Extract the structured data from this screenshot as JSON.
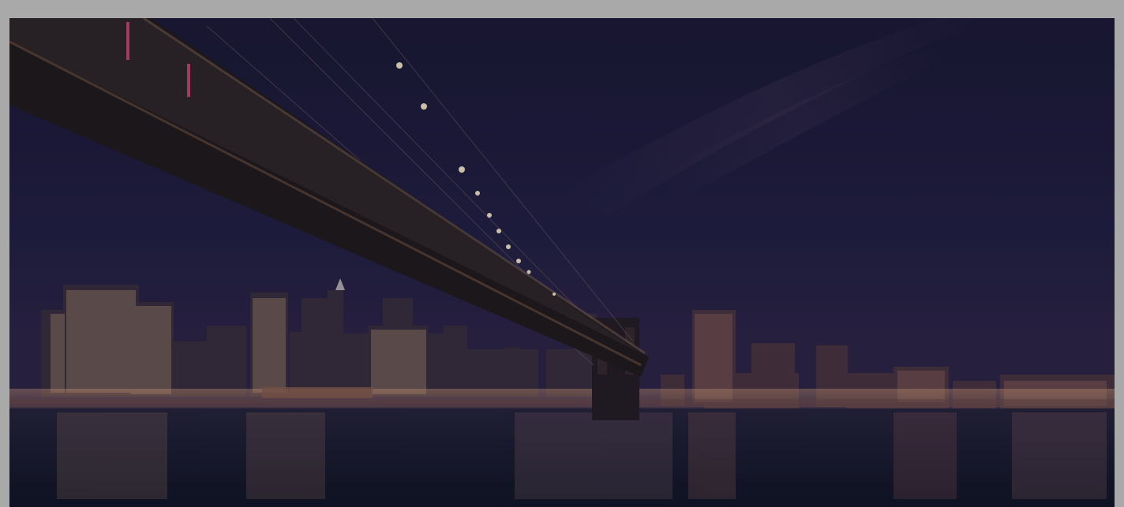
{
  "image": {
    "subject": "photo",
    "overlay": "dark"
  },
  "colors": {
    "frame": "#a9a9a9",
    "sky_top": "#1c1a3a",
    "sky_horizon": "#2a2348",
    "water": "#151a2e",
    "bridge": "#231c1e",
    "lights": "#f6e7c6"
  }
}
